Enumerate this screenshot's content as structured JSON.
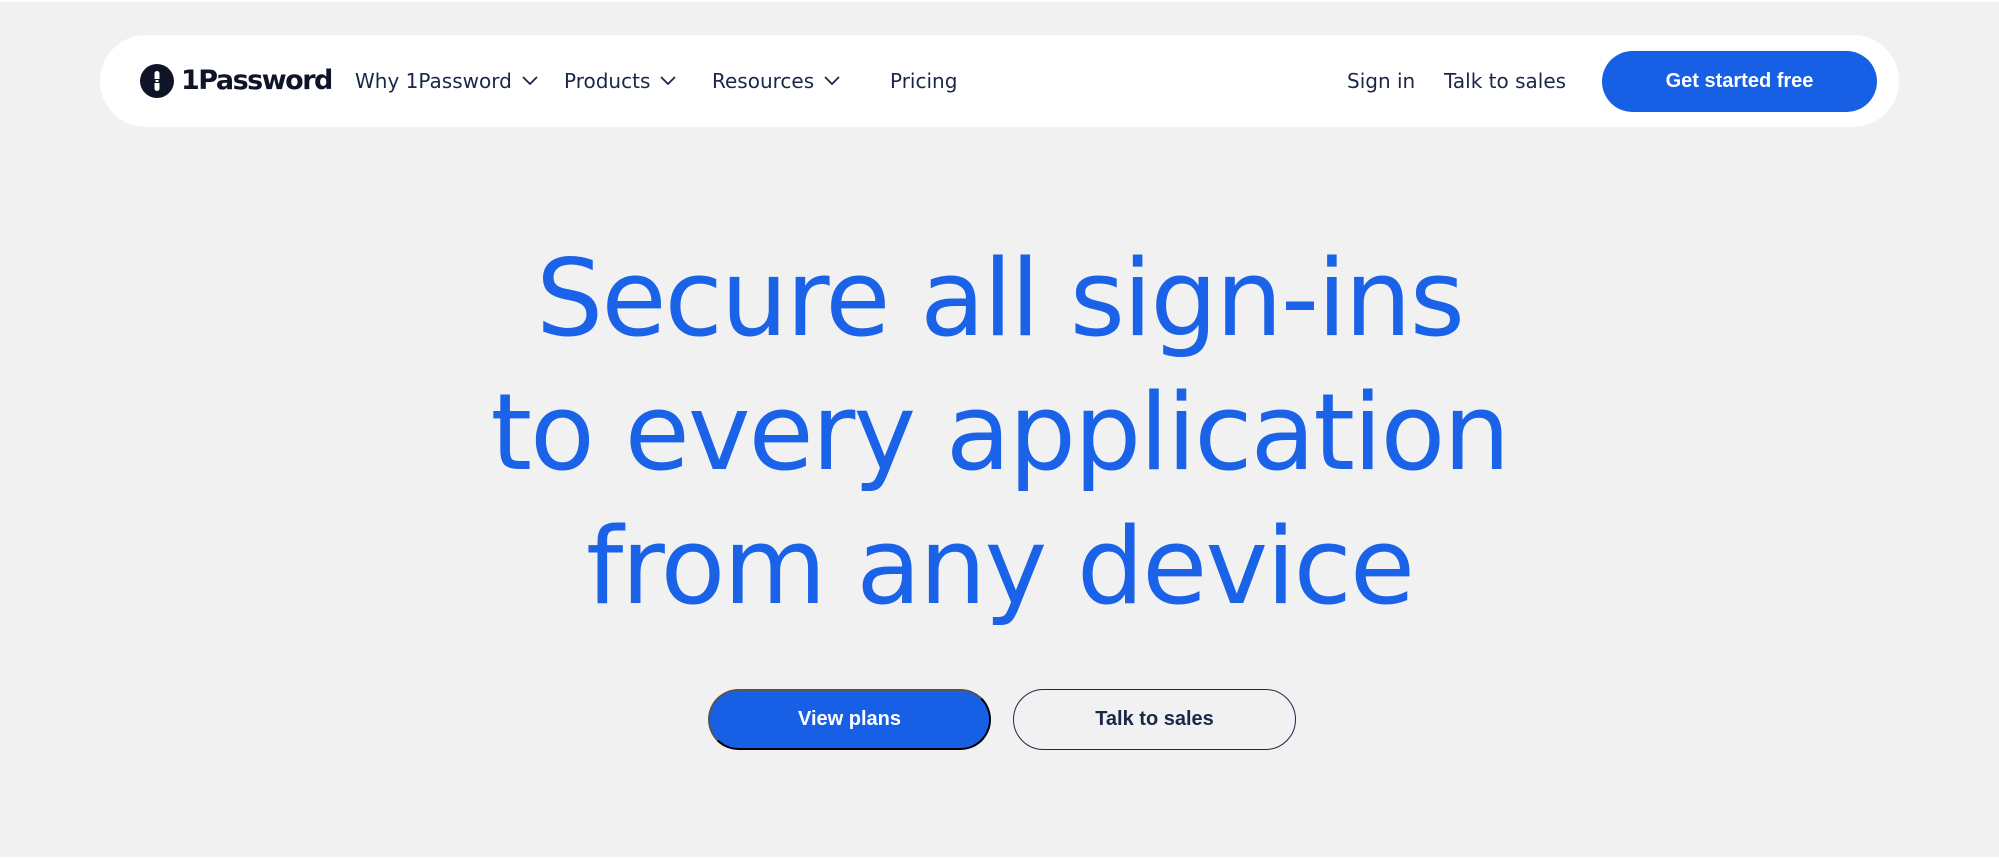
{
  "nav": {
    "brand": "1Password",
    "items": [
      {
        "label": "Why 1Password"
      },
      {
        "label": "Products"
      },
      {
        "label": "Resources"
      }
    ],
    "pricing": "Pricing",
    "sign_in": "Sign in",
    "talk_to_sales": "Talk to sales",
    "cta": "Get started free"
  },
  "hero": {
    "title_lines": [
      "Secure all sign-ins",
      "to every application",
      "from any device"
    ],
    "primary_button": "View plans",
    "secondary_button": "Talk to sales"
  },
  "colors": {
    "accent": "#1760e6",
    "headline": "#1a62e7",
    "text_dark": "#1a2748",
    "background": "#f1f1f1"
  },
  "icons": {
    "logo": "1password-keyhole-logo",
    "dropdown": "chevron-down-icon"
  }
}
